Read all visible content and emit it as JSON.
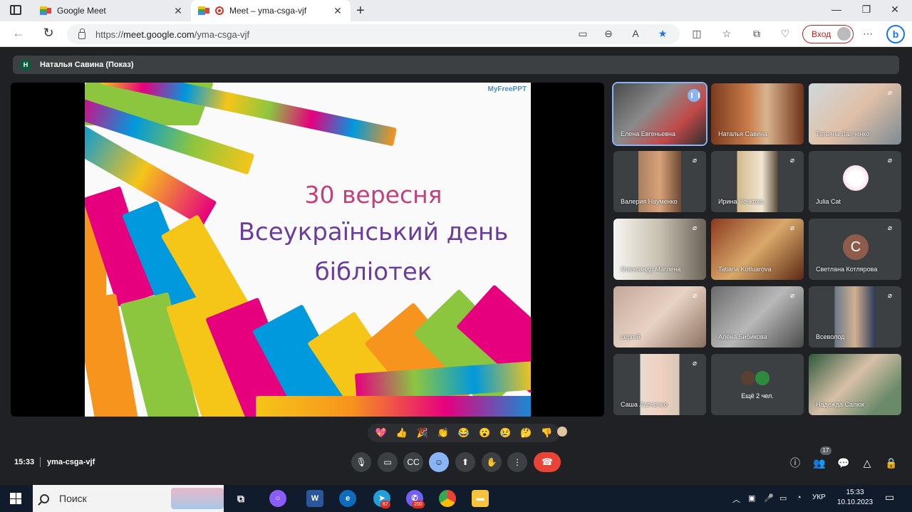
{
  "browser": {
    "tabs": [
      {
        "title": "Google Meet"
      },
      {
        "title": "Meet – yma-csga-vjf"
      }
    ],
    "url_prefix": "https://",
    "url_host": "meet.google.com",
    "url_path": "/yma-csga-vjf",
    "login_label": "Вход",
    "bing_label": "b"
  },
  "meet": {
    "presenter_initial": "Н",
    "presenter_label": "Наталья Савина (Показ)",
    "slide": {
      "brand": "MyFreePPT",
      "line1": "30 вересня",
      "line2": "Всеукраїнський день",
      "line3": "бібліотек"
    },
    "participants": [
      {
        "name": "Елена Евгеньевна"
      },
      {
        "name": "Наталья Савина"
      },
      {
        "name": "Татьяна Лапченко"
      },
      {
        "name": "Валерия Науменко"
      },
      {
        "name": "Ирина Чечкова"
      },
      {
        "name": "Julia Cat"
      },
      {
        "name": "Олександр Маглена"
      },
      {
        "name": "Tatiana Kotluarova"
      },
      {
        "name": "Светлана Котлярова",
        "initial": "С"
      },
      {
        "name": "сергей"
      },
      {
        "name": "Алёна Бибикова"
      },
      {
        "name": "Всеволод"
      },
      {
        "name": "Саша Лапченко"
      },
      {
        "name": "Ещё 2 чел.",
        "initial": "О"
      },
      {
        "name": "Надежда Салюк"
      }
    ],
    "reactions": [
      "💖",
      "👍",
      "🎉",
      "👏",
      "😂",
      "😮",
      "😢",
      "🤔",
      "👎"
    ],
    "time": "15:33",
    "meeting_code": "yma-csga-vjf",
    "participant_count": "17"
  },
  "taskbar": {
    "search_label": "Поиск",
    "badge_telegram": "67",
    "badge_viber": "200",
    "lang": "УКР",
    "time": "15:33",
    "date": "10.10.2023"
  }
}
